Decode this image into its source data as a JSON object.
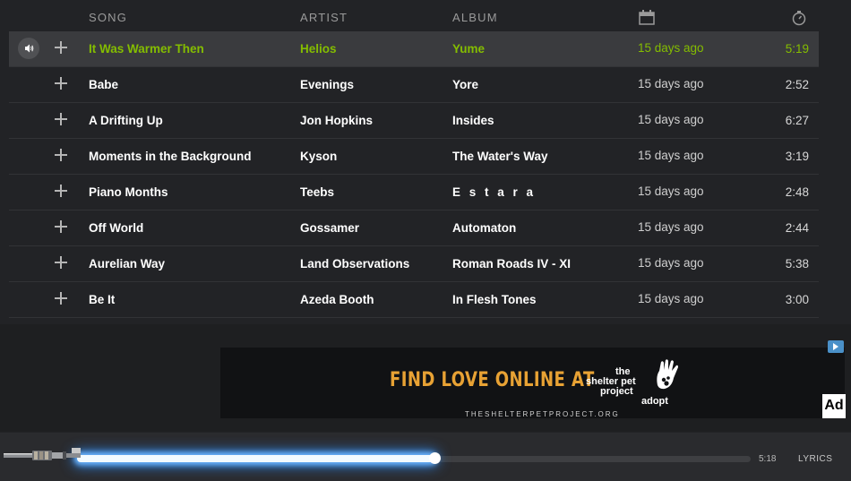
{
  "tracklist": {
    "columns": {
      "song": "SONG",
      "artist": "ARTIST",
      "album": "ALBUM"
    },
    "rows": [
      {
        "song": "It Was Warmer Then",
        "artist": "Helios",
        "album": "Yume",
        "added": "15 days ago",
        "duration": "5:19",
        "playing": true
      },
      {
        "song": "Babe",
        "artist": "Evenings",
        "album": "Yore",
        "added": "15 days ago",
        "duration": "2:52"
      },
      {
        "song": "A Drifting Up",
        "artist": "Jon Hopkins",
        "album": "Insides",
        "added": "15 days ago",
        "duration": "6:27"
      },
      {
        "song": "Moments in the Background",
        "artist": "Kyson",
        "album": "The Water's Way",
        "added": "15 days ago",
        "duration": "3:19"
      },
      {
        "song": "Piano Months",
        "artist": "Teebs",
        "album": "E s t a r a",
        "added": "15 days ago",
        "duration": "2:48"
      },
      {
        "song": "Off World",
        "artist": "Gossamer",
        "album": "Automaton",
        "added": "15 days ago",
        "duration": "2:44"
      },
      {
        "song": "Aurelian Way",
        "artist": "Land Observations",
        "album": "Roman Roads IV - XI",
        "added": "15 days ago",
        "duration": "5:38"
      },
      {
        "song": "Be It",
        "artist": "Azeda Booth",
        "album": "In Flesh Tones",
        "added": "15 days ago",
        "duration": "3:00"
      }
    ]
  },
  "ad": {
    "headline": "FIND LOVE ONLINE AT",
    "brand_line1": "the",
    "brand_line2": "shelter pet",
    "brand_line3": "project",
    "brand_line4": "adopt",
    "url": "THESHELTERPETPROJECT.ORG",
    "ad_label": "Ad"
  },
  "player": {
    "progress": 0.53,
    "elapsed": "5:18",
    "lyrics_label": "LYRICS"
  },
  "colors": {
    "accent": "#84bd00",
    "ad_headline": "#e8a234",
    "progress_glow": "#6fb7ff"
  },
  "icons": {
    "date_column": "calendar-icon",
    "duration_column": "stopwatch-icon",
    "now_playing": "speaker-icon",
    "add": "plus-icon"
  }
}
